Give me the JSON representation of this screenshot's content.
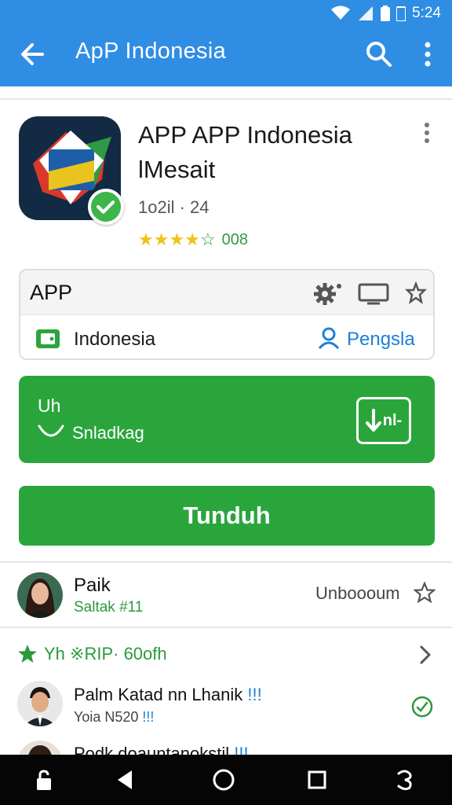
{
  "status_bar": {
    "time": "5:24"
  },
  "app_bar": {
    "title": "ApP Indonesia"
  },
  "app": {
    "title": "APP APP Indonesia lMesait",
    "meta": "1o2il · 24",
    "rating_stars": 4,
    "rating_max": 5,
    "rating_count": "008"
  },
  "info_card": {
    "label": "APP",
    "region": "Indonesia",
    "developer": "Pengsla"
  },
  "green_panel": {
    "size": "Uh",
    "subtitle": "Snladkag",
    "download_label": "nl-"
  },
  "main_button": {
    "label": "Tunduh"
  },
  "review": {
    "name": "Paik",
    "sub": "Saltak #11",
    "right_label": "Unboooum"
  },
  "section": {
    "title": "Yh ※RIP· 60ofh"
  },
  "rows": [
    {
      "name": "Palm Katad nn Lhanik",
      "tag": "!!!",
      "sub": "Yoia N520",
      "sub_tag": "!!!"
    },
    {
      "name": "Podk doauntanokstil",
      "tag": "!!!"
    }
  ],
  "colors": {
    "app_bar": "#2f8de4",
    "primary_green": "#2aa53c",
    "link_blue": "#1e7fd8",
    "star_yellow": "#f2c11b"
  },
  "icons": {
    "app_bar": [
      "back-arrow-icon",
      "search-icon",
      "more-vert-icon"
    ],
    "status": [
      "wifi-icon",
      "signal-icon",
      "battery-icon"
    ],
    "info_card": [
      "gear-icon",
      "screen-icon",
      "pin-icon",
      "tablet-icon",
      "person-icon"
    ],
    "nav": [
      "lock-icon",
      "back-icon",
      "home-icon",
      "recents-icon",
      "assistant-icon"
    ]
  }
}
